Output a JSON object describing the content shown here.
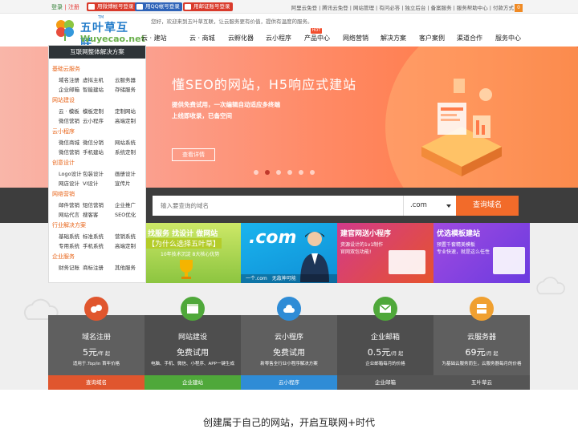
{
  "topbar": {
    "login": "登录",
    "sep": "|",
    "register": "注册",
    "quick_login": [
      "用微博帐号登录",
      "用QQ帐号登录",
      "用邮证账号登录"
    ],
    "links": [
      "阿里云免登",
      "腾讯云免登",
      "网站管理",
      "有问必答",
      "独立后台",
      "备案服务",
      "服务帮助中心",
      "付款方式"
    ],
    "cart_count": "0"
  },
  "header": {
    "logo_title": "五叶草互联",
    "logo_tm": "TM",
    "logo_domain": "Wuyecao.net",
    "welcome": "您好，欢迎来到五叶草互联，让云服务更有价值，提供有温度的服务。",
    "hot_badge": "HOT",
    "nav": [
      "云 · 建站",
      "云 · 商城",
      "云孵化器",
      "云小程序",
      "产品中心",
      "网络营销",
      "解决方案",
      "客户案例",
      "渠道合作",
      "服务中心"
    ]
  },
  "sidebar": {
    "title": "互联网整体解决方案",
    "categories": [
      {
        "name": "基础云服务",
        "rows": [
          [
            "域名注册",
            "虚拟主机",
            "云服务器"
          ],
          [
            "企业邮箱",
            "智能建站",
            "存储服务"
          ]
        ]
      },
      {
        "name": "网站建设",
        "rows": [
          [
            "云 · 模板",
            "模板定制",
            "定制网站"
          ],
          [
            "微信营销",
            "云小程序",
            "高端定制"
          ]
        ]
      },
      {
        "name": "云小程序",
        "rows": [
          [
            "微信商城",
            "微信分销",
            "网站系统"
          ],
          [
            "微信营销",
            "手机建站",
            "系统定制"
          ]
        ]
      },
      {
        "name": "创意设计",
        "rows": [
          [
            "Logo设计",
            "包装设计",
            "画册设计"
          ],
          [
            "网店设计",
            "VI设计",
            "宣传片"
          ]
        ]
      },
      {
        "name": "网络营销",
        "rows": [
          [
            "邮件营销",
            "短信营销",
            "企业推广"
          ],
          [
            "网站代言",
            "搜客客",
            "SEO优化"
          ]
        ]
      },
      {
        "name": "行业解决方案",
        "rows": [
          [
            "基础系统",
            "标准系统",
            "营销系统"
          ],
          [
            "专用系统",
            "手机系统",
            "高端定制"
          ]
        ]
      },
      {
        "name": "企业服务",
        "rows": [
          [
            "财务记账",
            "商标注册",
            "其他服务"
          ]
        ]
      }
    ]
  },
  "banner": {
    "headline": "懂SEO的网站，H5响应式建站",
    "sub1": "提供免费试用，一次编辑自动适应多终端",
    "sub2": "上线即收录，已备空间",
    "button": "查看详情",
    "slides": 6,
    "active_slide": 2
  },
  "search": {
    "placeholder": "输入要查询的域名",
    "tld": ".com",
    "button": "查询域名"
  },
  "promos": [
    {
      "line1": "找服务 找设计 做网站",
      "line2": "【为什么选择五叶草】",
      "line3": "10年技术沉淀 8大核心优势"
    },
    {
      "line1": ".com",
      "line2": "一个.com",
      "line3": "无敌神可能"
    },
    {
      "line1": "建官网送小程序",
      "line2": "资源设计的1v1制作",
      "line3": "官网双包功能!"
    },
    {
      "line1": "优选模板建站",
      "line2": "预置千套精美模板",
      "line3": "专业快速，就是这么任性"
    }
  ],
  "services": [
    {
      "title": "域名注册",
      "price": "5元",
      "unit": "/年 起",
      "desc": "适用于.Top/in 首年价格",
      "foot": "查询域名"
    },
    {
      "title": "网站建设",
      "price": "免费试用",
      "unit": "",
      "desc": "电脑、手机、微信、小程序、APP一键生成",
      "foot": "企业建站"
    },
    {
      "title": "云小程序",
      "price": "免费试用",
      "unit": "",
      "desc": "新零售全行业小程序解决方案",
      "foot": "云小程序"
    },
    {
      "title": "企业邮箱",
      "price": "0.5元",
      "unit": "/月 起",
      "desc": "企业邮箱每月的价格",
      "foot": "企业邮箱"
    },
    {
      "title": "云服务器",
      "price": "69元",
      "unit": "/月 起",
      "desc": "为基础云服务而生，云服务器每月的价格",
      "foot": "五叶草云"
    }
  ],
  "slogan": "创建属于自己的网站，开启互联网+时代",
  "colors": {
    "accent": "#f26b2a",
    "green": "#4fa83a",
    "blue": "#2f8cd6",
    "dark": "#3d3d3d"
  }
}
